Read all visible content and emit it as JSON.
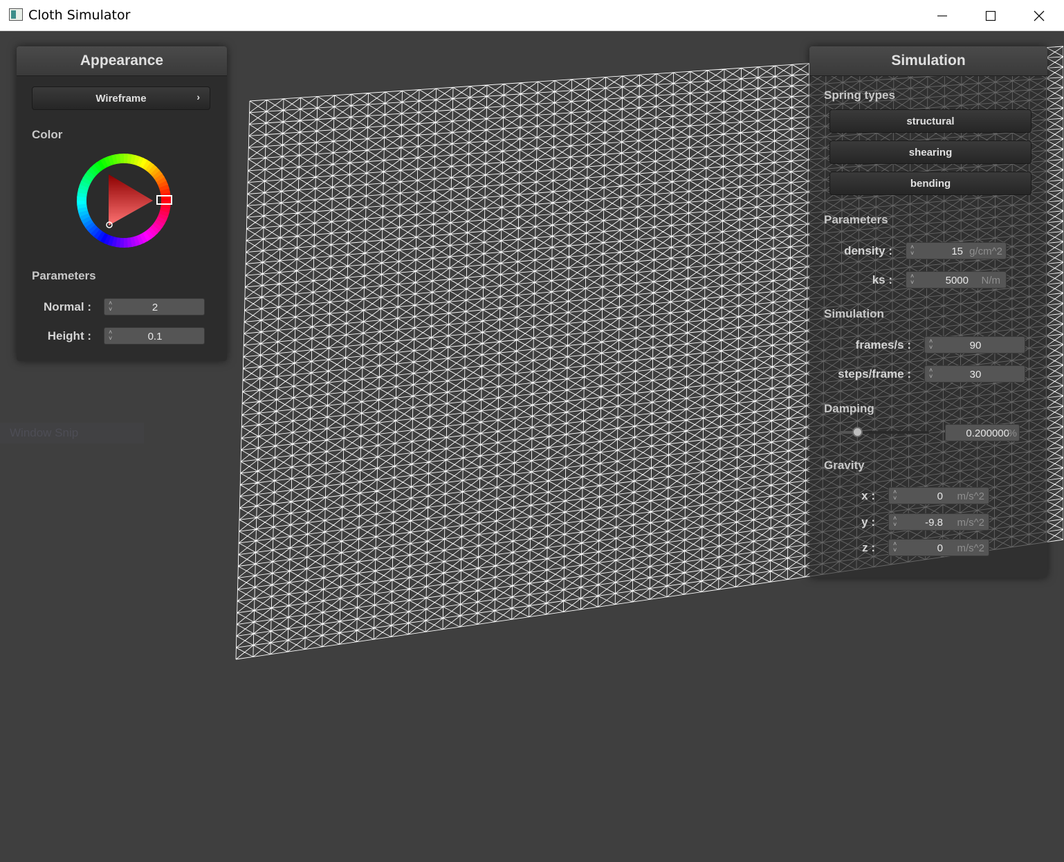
{
  "window": {
    "title": "Cloth Simulator"
  },
  "appearance": {
    "header": "Appearance",
    "shading_mode": "Wireframe",
    "color_label": "Color",
    "selected_color": "#ff0000",
    "parameters_label": "Parameters",
    "normal": {
      "label": "Normal :",
      "value": "2"
    },
    "height": {
      "label": "Height :",
      "value": "0.1"
    }
  },
  "simulation": {
    "header": "Simulation",
    "spring_types_label": "Spring types",
    "spring_types": [
      "structural",
      "shearing",
      "bending"
    ],
    "parameters_label": "Parameters",
    "density": {
      "label": "density :",
      "value": "15",
      "unit": "g/cm^2"
    },
    "ks": {
      "label": "ks :",
      "value": "5000",
      "unit": "N/m"
    },
    "simulation_label": "Simulation",
    "frames_per_s": {
      "label": "frames/s :",
      "value": "90"
    },
    "steps_per_frame": {
      "label": "steps/frame :",
      "value": "30"
    },
    "damping_label": "Damping",
    "damping": {
      "value": "0.200000",
      "unit": "%",
      "slider_fraction": 0.2
    },
    "gravity_label": "Gravity",
    "gravity_x": {
      "label": "x :",
      "value": "0",
      "unit": "m/s^2"
    },
    "gravity_y": {
      "label": "y :",
      "value": "-9.8",
      "unit": "m/s^2"
    },
    "gravity_z": {
      "label": "z :",
      "value": "0",
      "unit": "m/s^2"
    }
  },
  "watermark": "Window Snip"
}
